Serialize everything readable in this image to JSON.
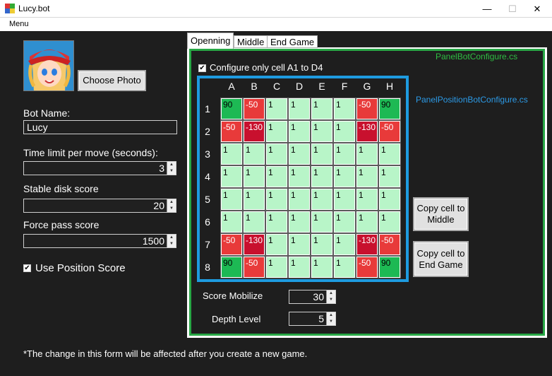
{
  "window": {
    "title": "Lucy.bot",
    "minimize": "—",
    "maximize": "☐",
    "close": "✕"
  },
  "menu": {
    "label": "Menu"
  },
  "left": {
    "choose_photo": "Choose Photo",
    "bot_name_label": "Bot Name:",
    "bot_name_value": "Lucy",
    "time_limit_label": "Time limit per move (seconds):",
    "time_limit_value": "3",
    "stable_label": "Stable disk score",
    "stable_value": "20",
    "force_label": "Force pass score",
    "force_value": "1500",
    "use_position_label": "Use Position Score",
    "use_position_checked": true
  },
  "tabs": [
    {
      "label": "Openning",
      "selected": true
    },
    {
      "label": "Middle",
      "selected": false
    },
    {
      "label": "End Game",
      "selected": false
    }
  ],
  "panel": {
    "panel_label": "PanelBotConfigure.cs",
    "position_label": "PanelPositionBotConfigure.cs",
    "configure_label": "Configure only cell A1 to D4",
    "configure_checked": true,
    "columns": [
      "A",
      "B",
      "C",
      "D",
      "E",
      "F",
      "G",
      "H"
    ],
    "rows": [
      "1",
      "2",
      "3",
      "4",
      "5",
      "6",
      "7",
      "8"
    ],
    "cells": [
      [
        "90",
        "-50",
        "1",
        "1",
        "1",
        "1",
        "-50",
        "90"
      ],
      [
        "-50",
        "-130",
        "1",
        "1",
        "1",
        "1",
        "-130",
        "-50"
      ],
      [
        "1",
        "1",
        "1",
        "1",
        "1",
        "1",
        "1",
        "1"
      ],
      [
        "1",
        "1",
        "1",
        "1",
        "1",
        "1",
        "1",
        "1"
      ],
      [
        "1",
        "1",
        "1",
        "1",
        "1",
        "1",
        "1",
        "1"
      ],
      [
        "1",
        "1",
        "1",
        "1",
        "1",
        "1",
        "1",
        "1"
      ],
      [
        "-50",
        "-130",
        "1",
        "1",
        "1",
        "1",
        "-130",
        "-50"
      ],
      [
        "90",
        "-50",
        "1",
        "1",
        "1",
        "1",
        "-50",
        "90"
      ]
    ],
    "copy_middle": "Copy cell to Middle",
    "copy_end": "Copy cell to End Game",
    "score_mobilize_label": "Score Mobilize",
    "score_mobilize_value": "30",
    "depth_label": "Depth Level",
    "depth_value": "5"
  },
  "colors": {
    "positive_high": "#1db954",
    "negative": "#e83a3a",
    "negative_high": "#c8102e",
    "neutral": "#b8f5c8"
  },
  "footer": "*The change in this form will be affected after you create a new game."
}
